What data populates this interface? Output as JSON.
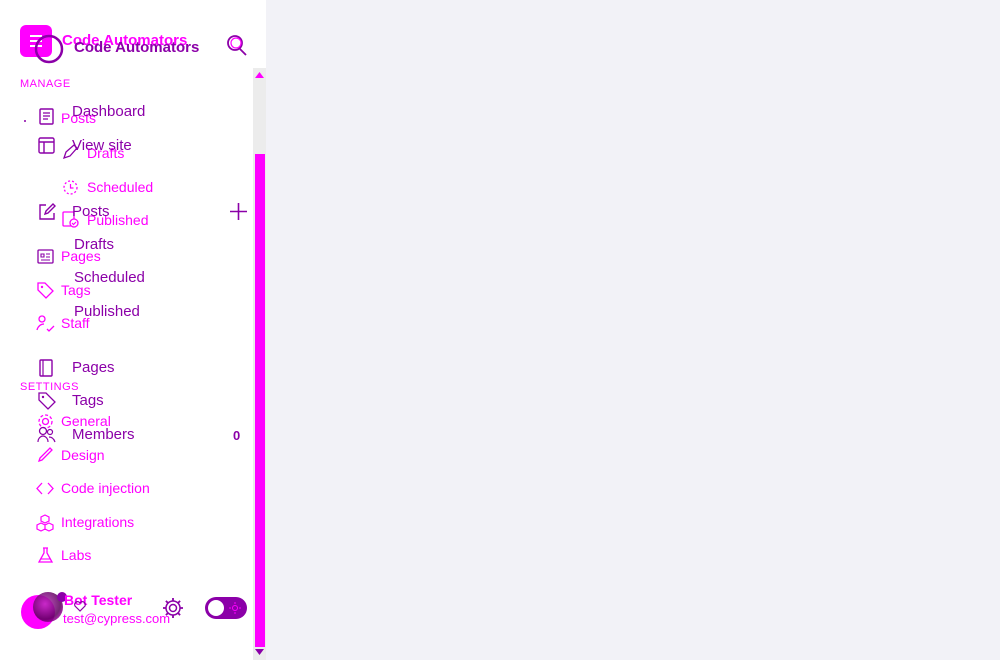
{
  "brand": {
    "name_back": "Code Automators",
    "name_front": "Code Automators"
  },
  "sections": {
    "manage": "MANAGE",
    "settings": "SETTINGS"
  },
  "nav_back": {
    "posts": "Posts",
    "drafts": "Drafts",
    "scheduled": "Scheduled",
    "published": "Published",
    "pages": "Pages",
    "tags": "Tags",
    "staff": "Staff",
    "general": "General",
    "design": "Design",
    "code_injection": "Code injection",
    "integrations": "Integrations",
    "labs": "Labs"
  },
  "nav_front": {
    "dashboard": "Dashboard",
    "view_site": "View site",
    "posts": "Posts",
    "drafts": "Drafts",
    "scheduled": "Scheduled",
    "published": "Published",
    "pages": "Pages",
    "tags": "Tags",
    "members": "Members",
    "members_count": "0"
  },
  "user": {
    "name": "Bot Tester",
    "email": "test@cypress.com"
  },
  "colors": {
    "accent": "#ff00ff",
    "accent_dark": "#8b00a8",
    "background": "#f2f2f7"
  },
  "icons": [
    "menu-icon",
    "search-icon",
    "posts-icon",
    "pencil-icon",
    "clock-icon",
    "published-icon",
    "layout-icon",
    "edit-icon",
    "plus-icon",
    "pages-icon",
    "tag-icon",
    "staff-icon",
    "book-icon",
    "members-icon",
    "gear-icon",
    "brush-icon",
    "code-icon",
    "integrations-icon",
    "labs-icon",
    "heart-icon"
  ]
}
